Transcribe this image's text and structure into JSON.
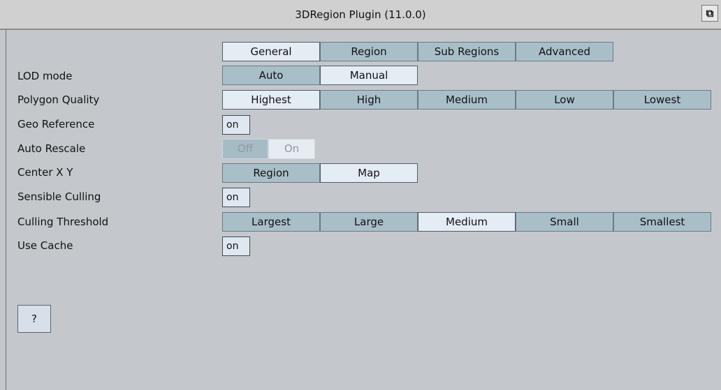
{
  "window": {
    "title": "3DRegion Plugin (11.0.0)",
    "close_symbol": "⧉"
  },
  "tabs": [
    {
      "label": "General",
      "selected": true
    },
    {
      "label": "Region",
      "selected": false
    },
    {
      "label": "Sub Regions",
      "selected": false
    },
    {
      "label": "Advanced",
      "selected": false
    }
  ],
  "fields": {
    "lod_mode": {
      "label": "LOD mode",
      "options": [
        "Auto",
        "Manual"
      ],
      "selected": "Manual"
    },
    "polygon_quality": {
      "label": "Polygon Quality",
      "options": [
        "Highest",
        "High",
        "Medium",
        "Low",
        "Lowest"
      ],
      "selected": "Highest"
    },
    "geo_reference": {
      "label": "Geo Reference",
      "value": "on"
    },
    "auto_rescale": {
      "label": "Auto Rescale",
      "options": [
        "Off",
        "On"
      ],
      "selected": "On"
    },
    "center_xy": {
      "label": "Center X Y",
      "options": [
        "Region",
        "Map"
      ],
      "selected": "Map"
    },
    "sensible_culling": {
      "label": "Sensible Culling",
      "value": "on"
    },
    "culling_threshold": {
      "label": "Culling Threshold",
      "options": [
        "Largest",
        "Large",
        "Medium",
        "Small",
        "Smallest"
      ],
      "selected": "Medium"
    },
    "use_cache": {
      "label": "Use Cache",
      "value": "on"
    }
  },
  "help_button": {
    "label": "?"
  },
  "colors": {
    "background": "#c4c8cc",
    "segment_off": "#a9bfc8",
    "segment_on": "#e4ecf4"
  }
}
